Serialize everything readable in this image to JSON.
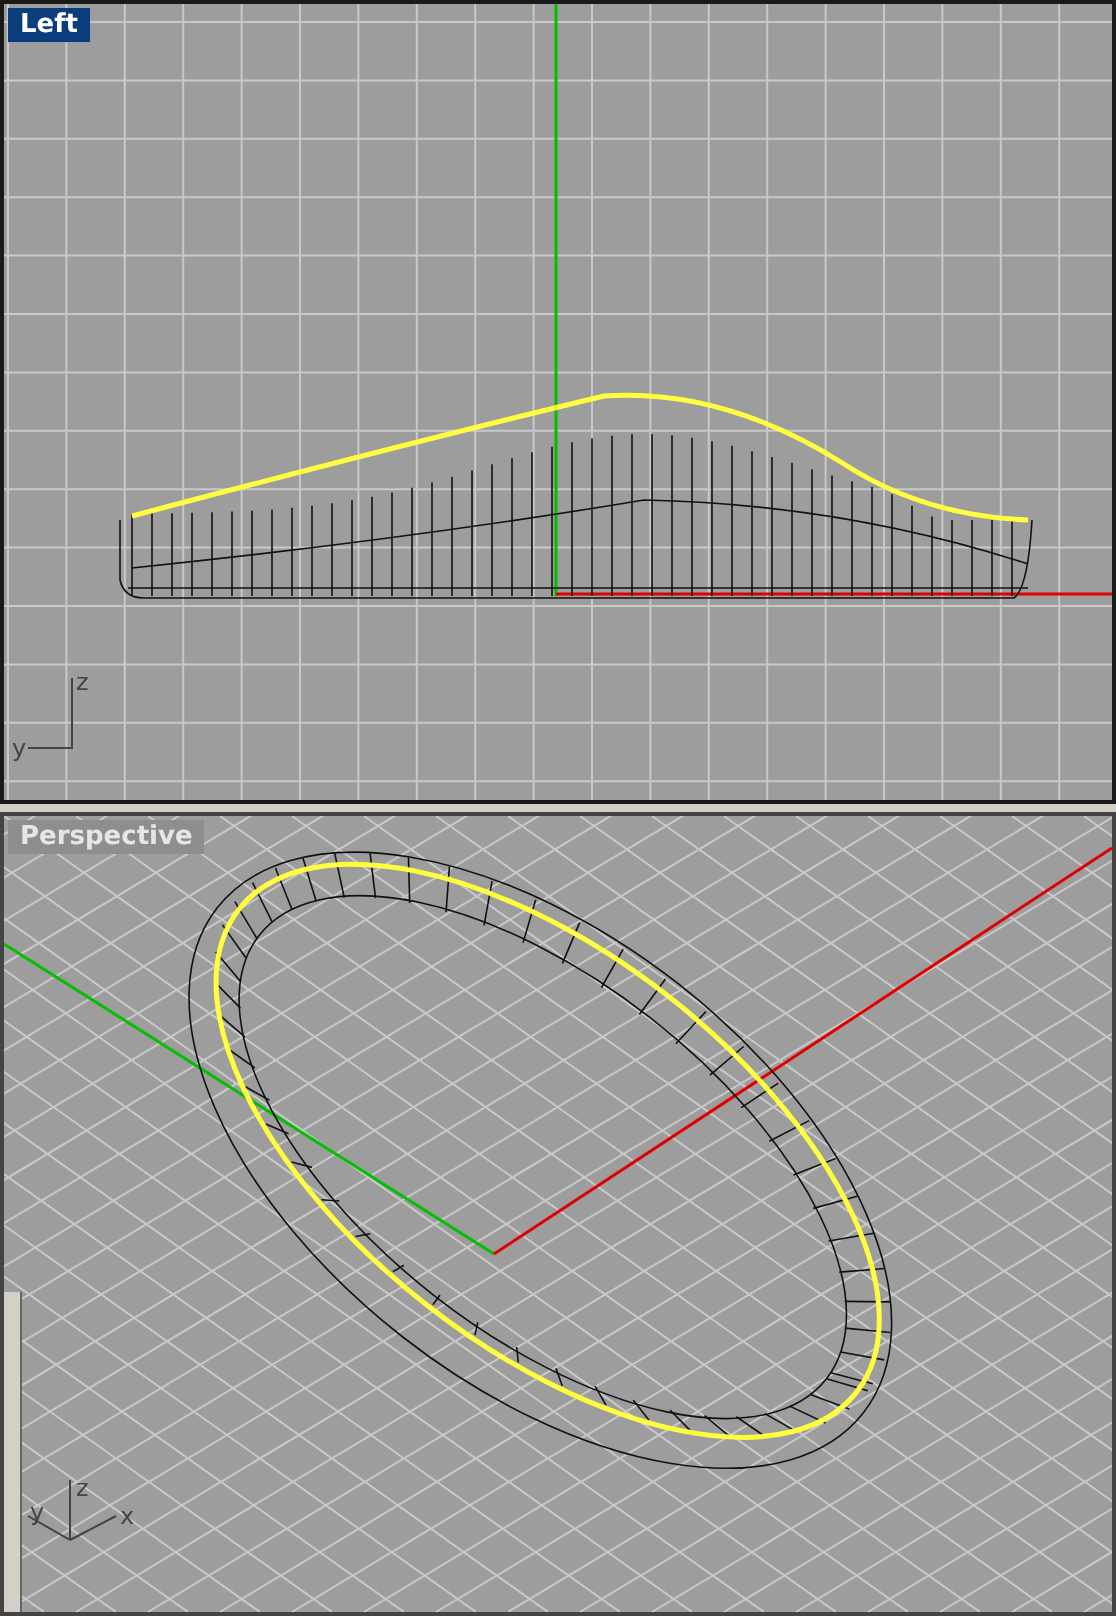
{
  "viewports": [
    {
      "kind": "ortho",
      "title": "Left",
      "selected": true,
      "axes": [
        "y",
        "z"
      ]
    },
    {
      "kind": "perspective",
      "title": "Perspective",
      "selected": false,
      "axes": [
        "y",
        "z",
        "x"
      ]
    }
  ]
}
